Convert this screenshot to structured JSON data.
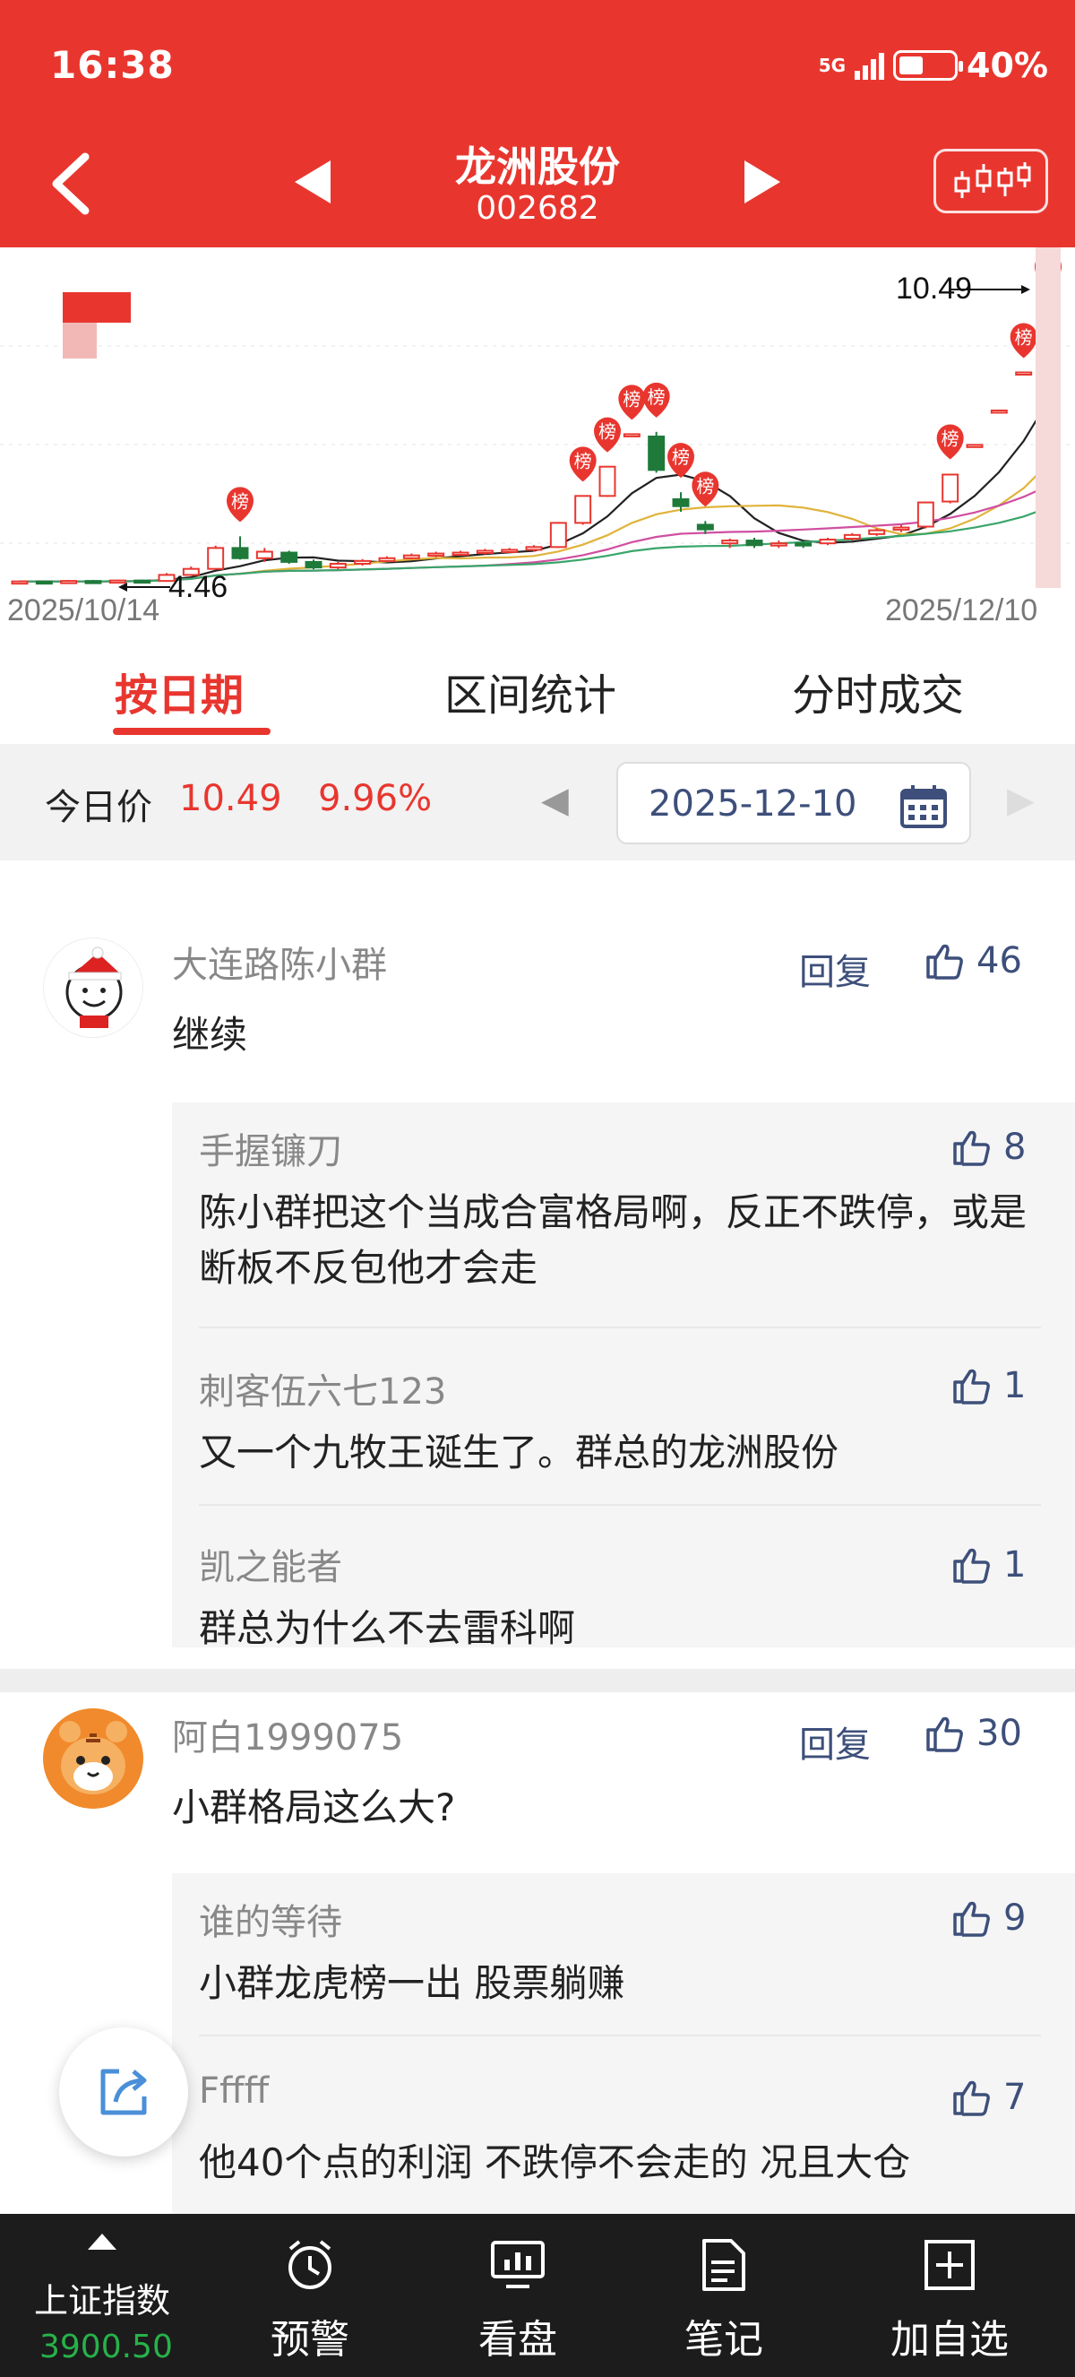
{
  "status": {
    "time": "16:38",
    "network": "5G",
    "battery": "40%"
  },
  "header": {
    "stock_name": "龙洲股份",
    "stock_code": "002682"
  },
  "chart_data": {
    "type": "candlestick",
    "start_date": "2025/10/14",
    "end_date": "2025/12/10",
    "low_label": "4.46",
    "high_label": "10.49",
    "badge_text": "榜",
    "ylim": [
      4.3,
      10.9
    ],
    "ma_lines": 4,
    "candles": [
      {
        "o": 4.47,
        "c": 4.48,
        "h": 4.5,
        "l": 4.46
      },
      {
        "o": 4.48,
        "c": 4.47,
        "h": 4.5,
        "l": 4.46
      },
      {
        "o": 4.47,
        "c": 4.49,
        "h": 4.51,
        "l": 4.46
      },
      {
        "o": 4.49,
        "c": 4.48,
        "h": 4.51,
        "l": 4.46
      },
      {
        "o": 4.48,
        "c": 4.5,
        "h": 4.52,
        "l": 4.47
      },
      {
        "o": 4.5,
        "c": 4.49,
        "h": 4.52,
        "l": 4.47
      },
      {
        "o": 4.49,
        "c": 4.62,
        "h": 4.66,
        "l": 4.48
      },
      {
        "o": 4.62,
        "c": 4.75,
        "h": 4.8,
        "l": 4.6
      },
      {
        "o": 4.75,
        "c": 5.2,
        "h": 5.25,
        "l": 4.74
      },
      {
        "o": 5.2,
        "c": 4.98,
        "h": 5.45,
        "l": 4.95
      },
      {
        "o": 4.98,
        "c": 5.12,
        "h": 5.2,
        "l": 4.9
      },
      {
        "o": 5.1,
        "c": 4.9,
        "h": 5.14,
        "l": 4.86
      },
      {
        "o": 4.9,
        "c": 4.78,
        "h": 4.95,
        "l": 4.74
      },
      {
        "o": 4.78,
        "c": 4.86,
        "h": 4.9,
        "l": 4.74
      },
      {
        "o": 4.86,
        "c": 4.92,
        "h": 4.96,
        "l": 4.82
      },
      {
        "o": 4.92,
        "c": 4.98,
        "h": 5.02,
        "l": 4.9
      },
      {
        "o": 4.98,
        "c": 5.04,
        "h": 5.08,
        "l": 4.96
      },
      {
        "o": 5.04,
        "c": 5.08,
        "h": 5.12,
        "l": 5.0
      },
      {
        "o": 5.08,
        "c": 5.1,
        "h": 5.14,
        "l": 5.04
      },
      {
        "o": 5.1,
        "c": 5.14,
        "h": 5.18,
        "l": 5.06
      },
      {
        "o": 5.14,
        "c": 5.16,
        "h": 5.2,
        "l": 5.1
      },
      {
        "o": 5.16,
        "c": 5.22,
        "h": 5.26,
        "l": 5.12
      },
      {
        "o": 5.22,
        "c": 5.74,
        "h": 5.76,
        "l": 5.2
      },
      {
        "o": 5.74,
        "c": 6.32,
        "h": 6.32,
        "l": 5.7
      },
      {
        "o": 6.32,
        "c": 6.95,
        "h": 6.95,
        "l": 6.3
      },
      {
        "o": 7.65,
        "c": 7.65,
        "h": 7.65,
        "l": 7.65
      },
      {
        "o": 7.6,
        "c": 6.88,
        "h": 7.7,
        "l": 6.82
      },
      {
        "o": 6.25,
        "c": 6.1,
        "h": 6.4,
        "l": 5.98
      },
      {
        "o": 5.7,
        "c": 5.6,
        "h": 5.78,
        "l": 5.5
      },
      {
        "o": 5.3,
        "c": 5.36,
        "h": 5.4,
        "l": 5.2
      },
      {
        "o": 5.36,
        "c": 5.26,
        "h": 5.42,
        "l": 5.2
      },
      {
        "o": 5.28,
        "c": 5.3,
        "h": 5.36,
        "l": 5.2
      },
      {
        "o": 5.3,
        "c": 5.26,
        "h": 5.34,
        "l": 5.2
      },
      {
        "o": 5.3,
        "c": 5.38,
        "h": 5.42,
        "l": 5.26
      },
      {
        "o": 5.4,
        "c": 5.48,
        "h": 5.52,
        "l": 5.36
      },
      {
        "o": 5.5,
        "c": 5.58,
        "h": 5.62,
        "l": 5.46
      },
      {
        "o": 5.6,
        "c": 5.64,
        "h": 5.7,
        "l": 5.54
      },
      {
        "o": 5.66,
        "c": 6.18,
        "h": 6.2,
        "l": 5.62
      },
      {
        "o": 6.2,
        "c": 6.78,
        "h": 6.8,
        "l": 6.16
      },
      {
        "o": 7.42,
        "c": 7.42,
        "h": 7.42,
        "l": 7.42
      },
      {
        "o": 8.16,
        "c": 8.16,
        "h": 8.16,
        "l": 8.16
      },
      {
        "o": 8.98,
        "c": 8.98,
        "h": 8.98,
        "l": 8.98
      },
      {
        "o": 9.6,
        "c": 10.49,
        "h": 10.49,
        "l": 8.9
      }
    ],
    "badges": [
      9,
      23,
      24,
      25,
      26,
      27,
      28,
      38,
      41,
      42
    ]
  },
  "tabs": [
    {
      "label": "按日期",
      "active": true
    },
    {
      "label": "区间统计",
      "active": false
    },
    {
      "label": "分时成交",
      "active": false
    }
  ],
  "price_row": {
    "label": "今日价",
    "price": "10.49",
    "change_pct": "9.96%",
    "date": "2025-12-10"
  },
  "comments": [
    {
      "user": "大连路陈小群",
      "text": "继续",
      "reply_label": "回复",
      "likes": "46",
      "replies": [
        {
          "user": "手握镰刀",
          "text": "陈小群把这个当成合富格局啊，反正不跌停，或是断板不反包他才会走",
          "likes": "8"
        },
        {
          "user": "刺客伍六七123",
          "text": "又一个九牧王诞生了。群总的龙洲股份",
          "likes": "1"
        },
        {
          "user": "凯之能者",
          "text": "群总为什么不去雷科啊",
          "likes": "1"
        }
      ]
    },
    {
      "user": "阿白1999075",
      "text": "小群格局这么大?",
      "reply_label": "回复",
      "likes": "30",
      "replies": [
        {
          "user": "谁的等待",
          "text": "小群龙虎榜一出 股票躺赚",
          "likes": "9"
        },
        {
          "user": "Fffff",
          "text": "他40个点的利润 不跌停不会走的 况且大仓",
          "likes": "7"
        }
      ]
    }
  ],
  "bottom": {
    "index_name": "上证指数",
    "index_value": "3900.50",
    "nav": [
      "预警",
      "看盘",
      "笔记",
      "加自选"
    ]
  },
  "colors": {
    "brand_red": "#e8362f",
    "down_green": "#1f7a3a",
    "link_blue": "#3d4f7a",
    "index_green": "#27b24a"
  }
}
